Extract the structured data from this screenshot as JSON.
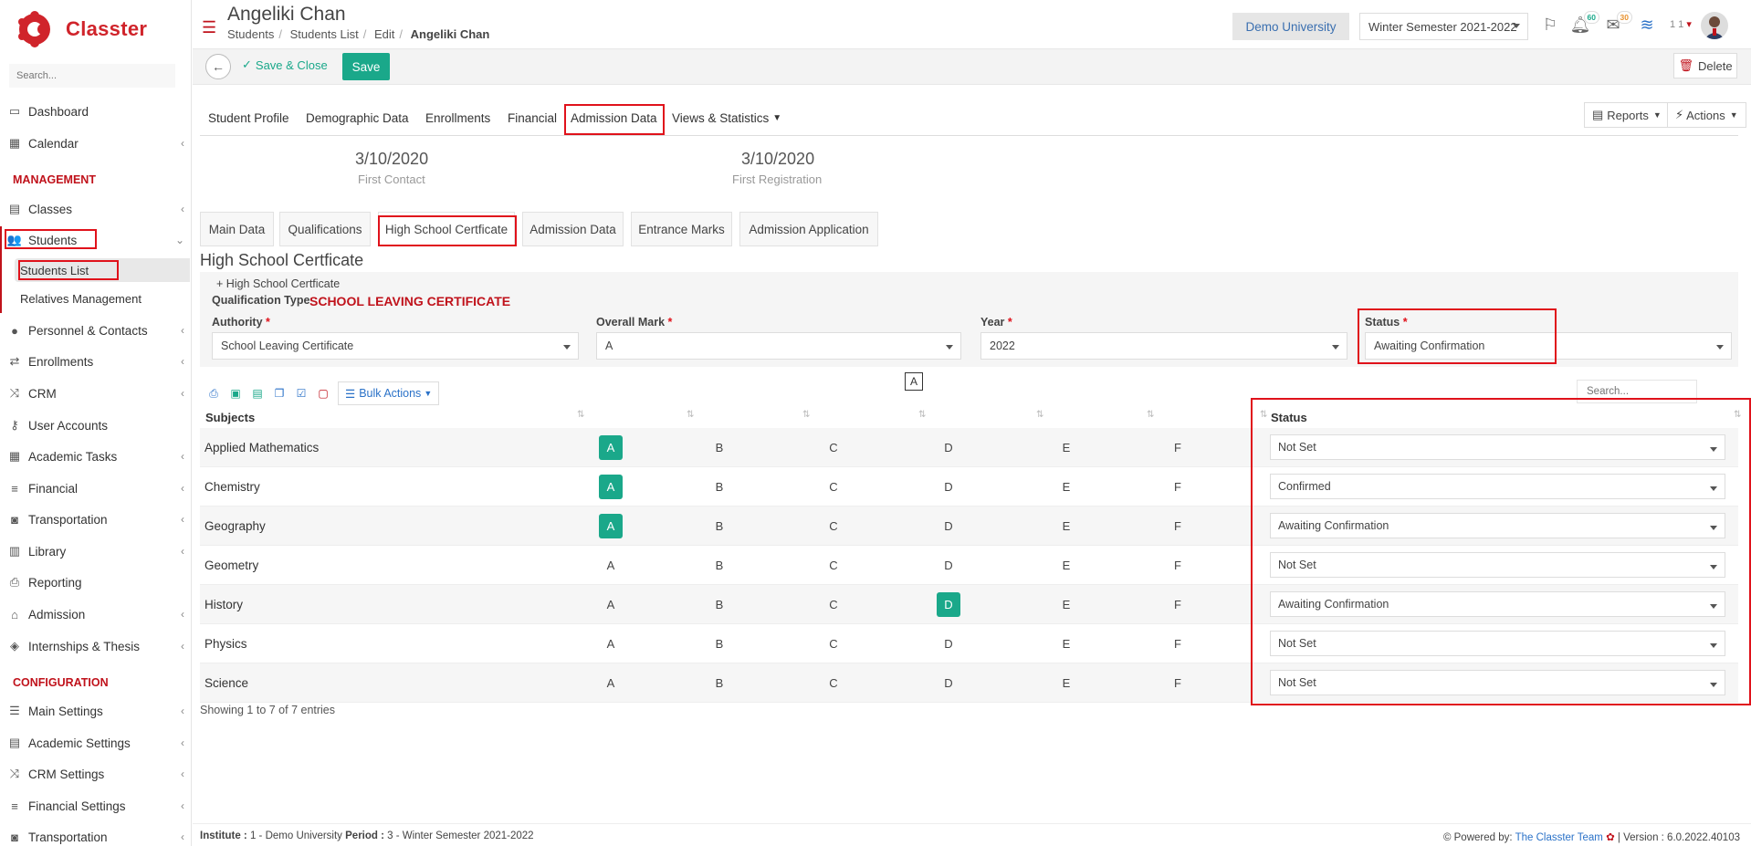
{
  "app": {
    "name": "Classter"
  },
  "sidebar": {
    "search_placeholder": "Search...",
    "items": [
      {
        "label": "Dashboard",
        "icon": "laptop-icon"
      },
      {
        "label": "Calendar",
        "icon": "calendar-icon"
      },
      {
        "label": "Classes",
        "icon": "classes-icon"
      },
      {
        "label": "Students",
        "icon": "students-icon"
      },
      {
        "label": "Personnel & Contacts",
        "icon": "person-icon"
      },
      {
        "label": "Enrollments",
        "icon": "exchange-icon"
      },
      {
        "label": "CRM",
        "icon": "crm-icon"
      },
      {
        "label": "User Accounts",
        "icon": "key-icon"
      },
      {
        "label": "Academic Tasks",
        "icon": "grid-icon"
      },
      {
        "label": "Financial",
        "icon": "coins-icon"
      },
      {
        "label": "Transportation",
        "icon": "bus-icon"
      },
      {
        "label": "Library",
        "icon": "books-icon"
      },
      {
        "label": "Reporting",
        "icon": "printer-icon"
      },
      {
        "label": "Admission",
        "icon": "building-icon"
      },
      {
        "label": "Internships & Thesis",
        "icon": "cube-icon"
      },
      {
        "label": "Main Settings",
        "icon": "sliders-icon"
      },
      {
        "label": "Academic Settings",
        "icon": "classes-icon"
      },
      {
        "label": "CRM Settings",
        "icon": "crm-icon"
      },
      {
        "label": "Financial Settings",
        "icon": "coins-icon"
      },
      {
        "label": "Transportation",
        "icon": "bus-icon"
      }
    ],
    "sections": {
      "management": "MANAGEMENT",
      "configuration": "CONFIGURATION"
    },
    "students_sub": [
      "Students List",
      "Relatives Management"
    ]
  },
  "header": {
    "title": "Angeliki Chan",
    "breadcrumb": [
      "Students",
      "Students List",
      "Edit",
      "Angeliki Chan"
    ],
    "university": "Demo University",
    "semester": "Winter Semester 2021-2022",
    "notif_count": "60",
    "mail_count": "30",
    "user_short": "1 1"
  },
  "toolbar": {
    "save_close": "Save & Close",
    "save": "Save",
    "delete": "Delete"
  },
  "tabs": [
    "Student Profile",
    "Demographic Data",
    "Enrollments",
    "Financial",
    "Admission Data",
    "Views & Statistics"
  ],
  "actions": {
    "reports": "Reports",
    "actions": "Actions"
  },
  "hero": {
    "first_contact_date": "3/10/2020",
    "first_contact_label": "First Contact",
    "first_registration_date": "3/10/2020",
    "first_registration_label": "First Registration"
  },
  "subtabs": [
    "Main Data",
    "Qualifications",
    "High School Certficate",
    "Admission Data",
    "Entrance Marks",
    "Admission Application"
  ],
  "section_title": "High School Certficate",
  "qualification": {
    "add_link": "High School Certficate",
    "type_label": "Qualification Type",
    "type_value": "SCHOOL LEAVING CERTIFICATE",
    "authority_label": "Authority",
    "authority_value": "School Leaving Certificate",
    "overall_mark_label": "Overall Mark",
    "overall_mark_value": "A",
    "year_label": "Year",
    "year_value": "2022",
    "status_label": "Status",
    "status_value": "Awaiting Confirmation"
  },
  "a_box": "A",
  "table": {
    "bulk_actions": "Bulk Actions",
    "search_placeholder": "Search...",
    "headers": {
      "subjects": "Subjects",
      "status": "Status"
    },
    "grades": [
      "A",
      "B",
      "C",
      "D",
      "E",
      "F"
    ],
    "rows": [
      {
        "subject": "Applied Mathematics",
        "selected": "A",
        "status": "Not Set"
      },
      {
        "subject": "Chemistry",
        "selected": "A",
        "status": "Confirmed"
      },
      {
        "subject": "Geography",
        "selected": "A",
        "status": "Awaiting Confirmation"
      },
      {
        "subject": "Geometry",
        "selected": "",
        "status": "Not Set"
      },
      {
        "subject": "History",
        "selected": "D",
        "status": "Awaiting Confirmation"
      },
      {
        "subject": "Physics",
        "selected": "",
        "status": "Not Set"
      },
      {
        "subject": "Science",
        "selected": "",
        "status": "Not Set"
      }
    ],
    "showing": "Showing 1 to 7 of 7 entries"
  },
  "footer": {
    "institute_label": "Institute :",
    "institute_value": "1 - Demo University",
    "period_label": "Period :",
    "period_value": "3 - Winter Semester 2021-2022",
    "powered": "Powered by:",
    "team": "The Classter Team",
    "version": "| Version : 6.0.2022.40103"
  },
  "colors": {
    "brand_red": "#d0242b",
    "accent_green": "#1aa88a",
    "link_blue": "#2b72c8"
  }
}
